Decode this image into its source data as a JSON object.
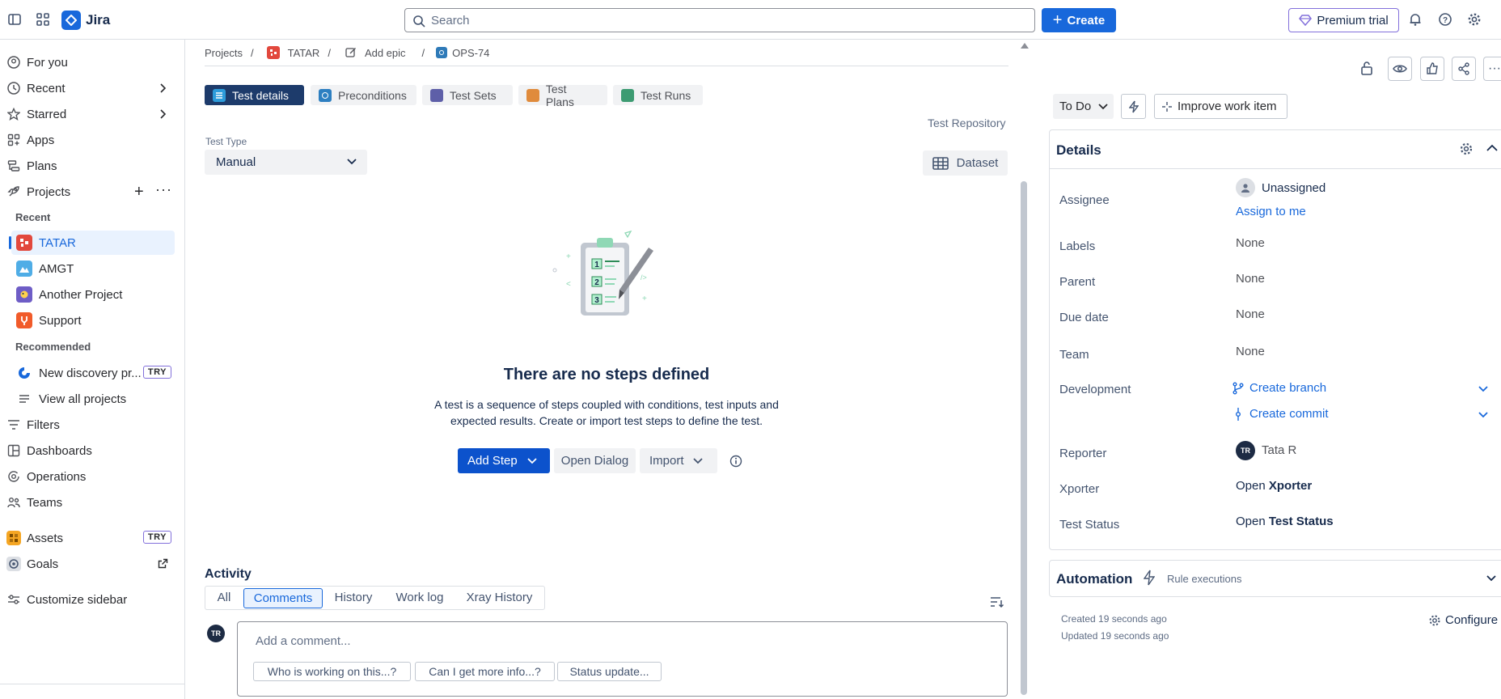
{
  "app": {
    "name": "Jira"
  },
  "topbar": {
    "search_placeholder": "Search",
    "create_label": "Create",
    "premium_label": "Premium trial"
  },
  "sidebar": {
    "for_you": "For you",
    "recent": "Recent",
    "starred": "Starred",
    "apps": "Apps",
    "plans": "Plans",
    "projects": "Projects",
    "recent_section": "Recent",
    "recent_projects": [
      {
        "name": "TATAR",
        "color": "#e2483d"
      },
      {
        "name": "AMGT",
        "color": "#4fade6"
      },
      {
        "name": "Another Project",
        "color": "#6e5dc6"
      },
      {
        "name": "Support",
        "color": "#f15b2a"
      }
    ],
    "recommended_section": "Recommended",
    "new_discovery": "New discovery pr...",
    "try_badge": "TRY",
    "view_all_projects": "View all projects",
    "filters": "Filters",
    "dashboards": "Dashboards",
    "operations": "Operations",
    "teams": "Teams",
    "assets": "Assets",
    "goals": "Goals",
    "customize": "Customize sidebar"
  },
  "breadcrumb": {
    "projects": "Projects",
    "project": "TATAR",
    "add_epic": "Add epic",
    "issue_key": "OPS-74"
  },
  "test_tabs": [
    "Test details",
    "Preconditions",
    "Test Sets",
    "Test Plans",
    "Test Runs"
  ],
  "test": {
    "repository_link": "Test Repository",
    "type_label": "Test Type",
    "type_value": "Manual",
    "dataset_label": "Dataset",
    "empty_title": "There are no steps defined",
    "empty_desc_line1": "A test is a sequence of steps coupled with conditions, test inputs and",
    "empty_desc_line2": "expected results. Create or import test steps to define the test.",
    "add_step": "Add Step",
    "open_dialog": "Open Dialog",
    "import": "Import",
    "illustration_numbers": [
      "1",
      "2",
      "3"
    ]
  },
  "activity": {
    "title": "Activity",
    "tabs": [
      "All",
      "Comments",
      "History",
      "Work log",
      "Xray History"
    ],
    "selected_tab": "Comments",
    "avatar_initials": "TR",
    "comment_placeholder": "Add a comment...",
    "quick_replies": [
      "Who is working on this...?",
      "Can I get more info...?",
      "Status update..."
    ]
  },
  "right_panel": {
    "status": "To Do",
    "improve": "Improve work item",
    "details_title": "Details",
    "fields": {
      "assignee_label": "Assignee",
      "assignee_value": "Unassigned",
      "assign_to_me": "Assign to me",
      "labels_label": "Labels",
      "labels_value": "None",
      "parent_label": "Parent",
      "parent_value": "None",
      "due_label": "Due date",
      "due_value": "None",
      "team_label": "Team",
      "team_value": "None",
      "development_label": "Development",
      "create_branch": "Create branch",
      "create_commit": "Create commit",
      "reporter_label": "Reporter",
      "reporter_initials": "TR",
      "reporter_value": "Tata R",
      "xporter_label": "Xporter",
      "xporter_prefix": "Open",
      "xporter_value": "Xporter",
      "test_status_label": "Test Status",
      "test_status_prefix": "Open",
      "test_status_value": "Test Status"
    },
    "automation_title": "Automation",
    "rule_executions": "Rule executions",
    "created": "Created 19 seconds ago",
    "updated": "Updated 19 seconds ago",
    "configure": "Configure"
  },
  "colors": {
    "brand": "#1868db",
    "active_tab": "#1d3b6b",
    "premium_border": "#8270db"
  }
}
